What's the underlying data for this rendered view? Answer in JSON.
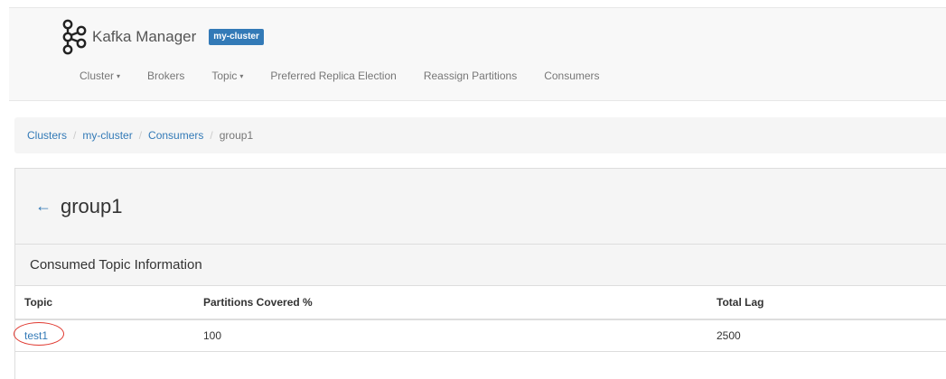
{
  "app": {
    "name": "Kafka Manager",
    "cluster_badge": "my-cluster"
  },
  "nav": {
    "items": [
      {
        "label": "Cluster",
        "has_dropdown": true
      },
      {
        "label": "Brokers",
        "has_dropdown": false
      },
      {
        "label": "Topic",
        "has_dropdown": true
      },
      {
        "label": "Preferred Replica Election",
        "has_dropdown": false
      },
      {
        "label": "Reassign Partitions",
        "has_dropdown": false
      },
      {
        "label": "Consumers",
        "has_dropdown": false
      }
    ]
  },
  "breadcrumb": {
    "items": [
      "Clusters",
      "my-cluster",
      "Consumers"
    ],
    "active": "group1"
  },
  "page": {
    "title": "group1",
    "back_icon": "left-arrow-icon"
  },
  "section": {
    "title": "Consumed Topic Information"
  },
  "table": {
    "headers": [
      "Topic",
      "Partitions Covered %",
      "Total Lag"
    ],
    "rows": [
      {
        "topic": "test1",
        "partitions_covered": "100",
        "total_lag": "2500"
      }
    ]
  },
  "colors": {
    "accent": "#337ab7",
    "highlight_circle": "#e0382f"
  }
}
